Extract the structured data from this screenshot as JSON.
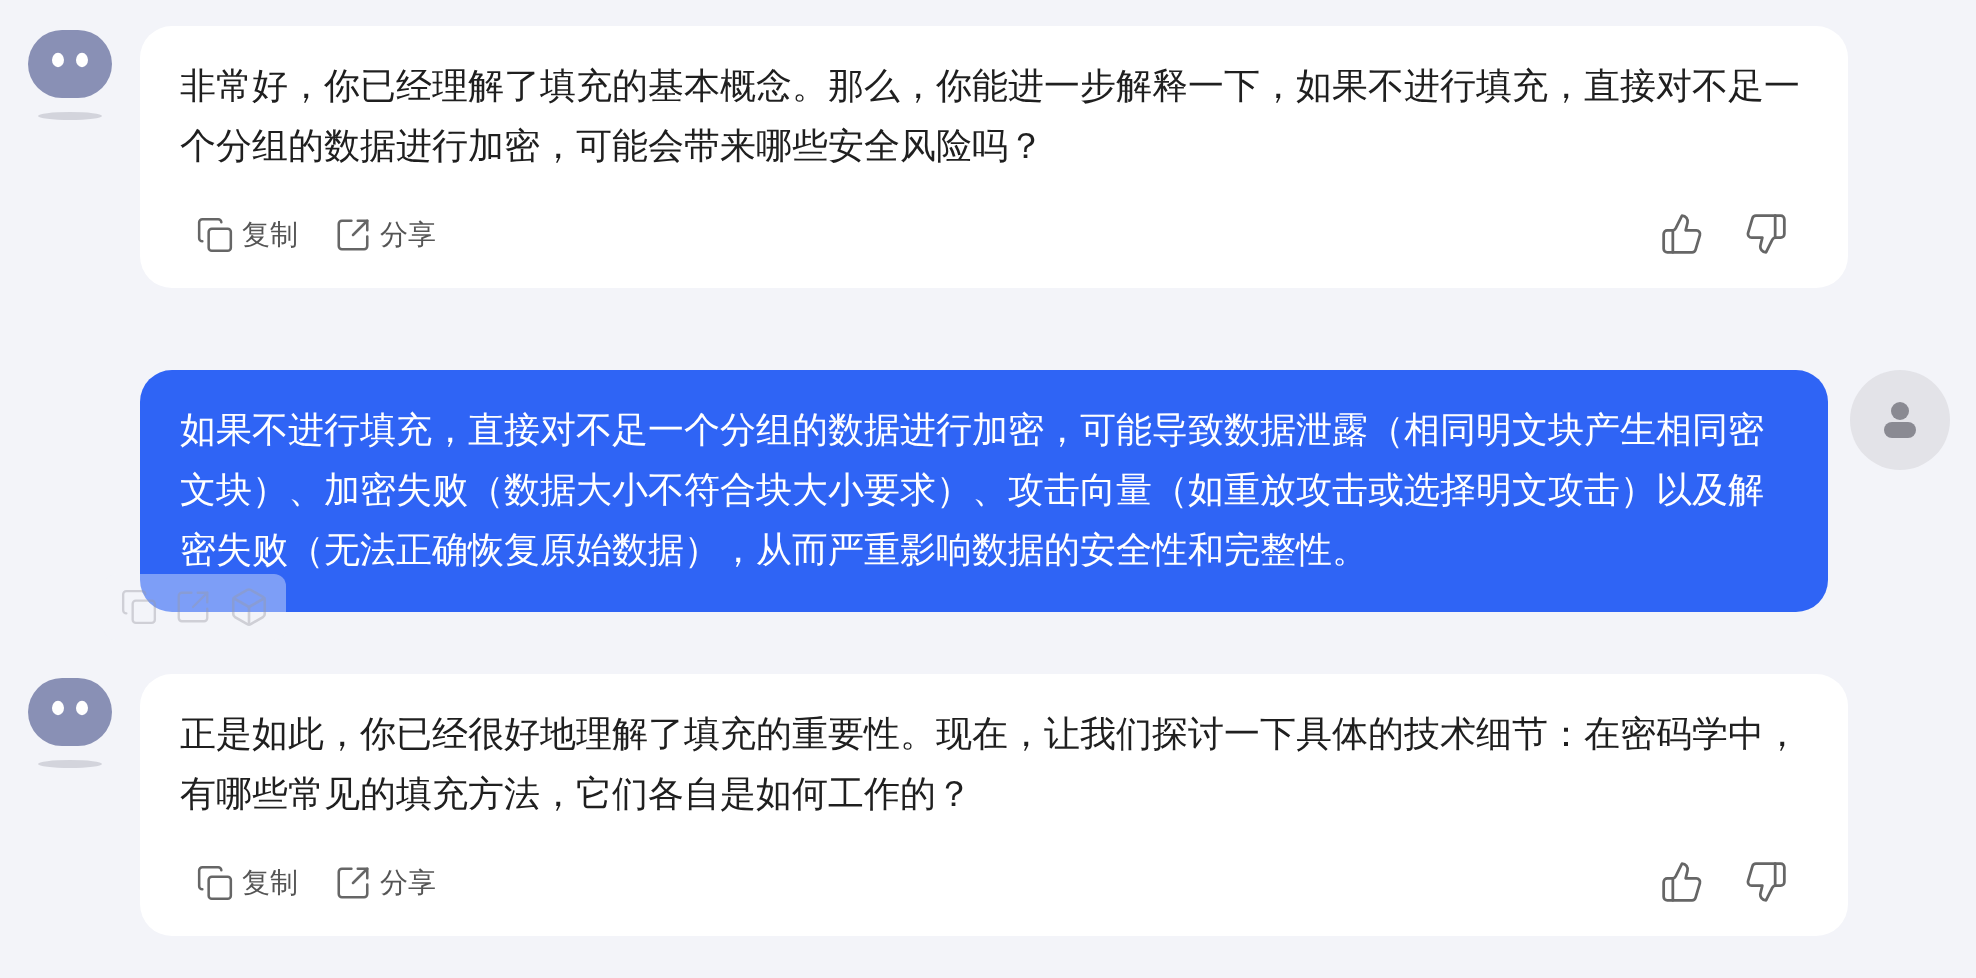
{
  "messages": [
    {
      "kind": "bot",
      "text": "非常好，你已经理解了填充的基本概念。那么，你能进一步解释一下，如果不进行填充，直接对不足一个分组的数据进行加密，可能会带来哪些安全风险吗？",
      "actions": [
        "复制",
        "分享"
      ]
    },
    {
      "kind": "user",
      "text": "如果不进行填充，直接对不足一个分组的数据进行加密，可能导致数据泄露（相同明文块产生相同密文块）、加密失败（数据大小不符合块大小要求）、攻击向量（如重放攻击或选择明文攻击）以及解密失败（无法正确恢复原始数据），从而严重影响数据的安全性和完整性。"
    },
    {
      "kind": "bot",
      "text": "正是如此，你已经很好地理解了填充的重要性。现在，让我们探讨一下具体的技术细节：在密码学中，有哪些常见的填充方法，它们各自是如何工作的？",
      "actions": [
        "复制",
        "分享"
      ]
    }
  ]
}
